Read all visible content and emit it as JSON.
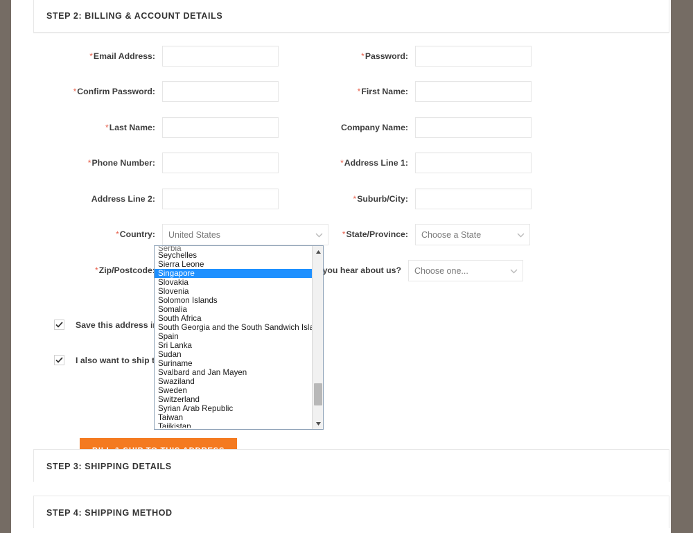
{
  "theme": {
    "page_background": "#756c64",
    "content_background": "#ffffff",
    "accent_orange": "#f47a20",
    "required_marker": "#e8604c",
    "selected_option": "#1e90ff",
    "border": "#e6e6e6"
  },
  "steps": {
    "step2": {
      "title": "STEP 2: BILLING & ACCOUNT DETAILS"
    },
    "step3": {
      "title": "STEP 3: SHIPPING DETAILS"
    },
    "step4": {
      "title": "STEP 4: SHIPPING METHOD"
    }
  },
  "fields": {
    "email": {
      "label": "Email Address:",
      "required": true,
      "value": "",
      "placeholder": ""
    },
    "password": {
      "label": "Password:",
      "required": true,
      "value": "",
      "placeholder": ""
    },
    "confirm_password": {
      "label": "Confirm Password:",
      "required": true,
      "value": "",
      "placeholder": ""
    },
    "first_name": {
      "label": "First Name:",
      "required": true,
      "value": "",
      "placeholder": ""
    },
    "last_name": {
      "label": "Last Name:",
      "required": true,
      "value": "",
      "placeholder": ""
    },
    "company_name": {
      "label": "Company Name:",
      "required": false,
      "value": "",
      "placeholder": ""
    },
    "phone_number": {
      "label": "Phone Number:",
      "required": true,
      "value": "",
      "placeholder": ""
    },
    "address_line_1": {
      "label": "Address Line 1:",
      "required": true,
      "value": "",
      "placeholder": ""
    },
    "address_line_2": {
      "label": "Address Line 2:",
      "required": false,
      "value": "",
      "placeholder": ""
    },
    "suburb_city": {
      "label": "Suburb/City:",
      "required": true,
      "value": "",
      "placeholder": ""
    },
    "country": {
      "label": "Country:",
      "required": true,
      "value": "United States"
    },
    "state_province": {
      "label": "State/Province:",
      "required": true,
      "value": "Choose a State"
    },
    "zip_postcode": {
      "label": "Zip/Postcode:",
      "required": true,
      "value": "",
      "placeholder": ""
    },
    "hear_about_us": {
      "label": "How did you hear about us?",
      "required": false,
      "value": "Choose one..."
    }
  },
  "country_dropdown": {
    "open": true,
    "selected": "Singapore",
    "clipped_top_option": "Serbia",
    "clipped_bottom_option": "Tajikistan",
    "visible_options": [
      "Seychelles",
      "Sierra Leone",
      "Singapore",
      "Slovakia",
      "Slovenia",
      "Solomon Islands",
      "Somalia",
      "South Africa",
      "South Georgia and the South Sandwich Islands",
      "Spain",
      "Sri Lanka",
      "Sudan",
      "Suriname",
      "Svalbard and Jan Mayen",
      "Swaziland",
      "Sweden",
      "Switzerland",
      "Syrian Arab Republic",
      "Taiwan"
    ]
  },
  "checkboxes": [
    {
      "label": "Save this address in my address book.",
      "checked": true
    },
    {
      "label": "I also want to ship to this address.",
      "checked": true
    }
  ],
  "submit": {
    "label": "Bill & Ship to this Address"
  },
  "icons": {
    "chevron_down": "chevron-down-icon",
    "scroll_up": "scroll-up-arrow-icon",
    "scroll_down": "scroll-down-arrow-icon",
    "checkmark": "checkmark-icon"
  }
}
